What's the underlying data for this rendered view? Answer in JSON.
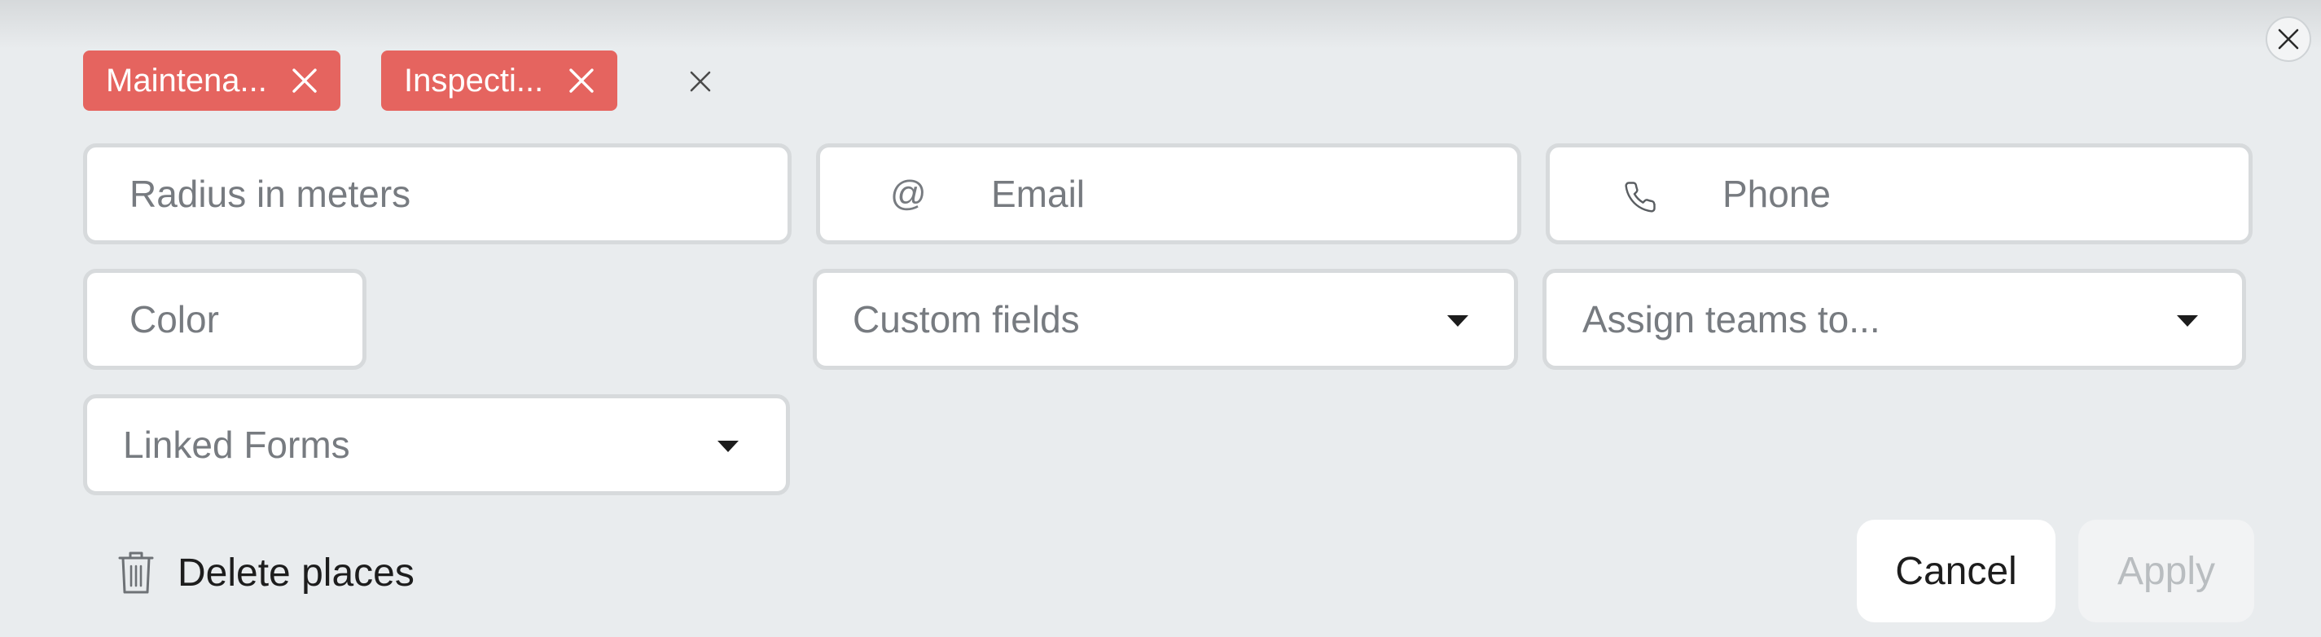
{
  "tags": [
    {
      "label": "Maintena..."
    },
    {
      "label": "Inspecti..."
    }
  ],
  "fields": {
    "radius": {
      "placeholder": "Radius in meters"
    },
    "email": {
      "icon_text": "@",
      "placeholder": "Email"
    },
    "phone": {
      "icon": "phone-icon",
      "placeholder": "Phone"
    },
    "color": {
      "placeholder": "Color"
    },
    "custom_fields": {
      "placeholder": "Custom fields"
    },
    "assign_teams": {
      "placeholder": "Assign teams to..."
    },
    "linked_forms": {
      "placeholder": "Linked Forms"
    }
  },
  "actions": {
    "delete_label": "Delete places",
    "cancel_label": "Cancel",
    "apply_label": "Apply"
  },
  "colors": {
    "tag_bg": "#e5645f",
    "background": "#e9ecee",
    "field_border": "#d7dadc",
    "apply_disabled_text": "#b9bdc0"
  }
}
